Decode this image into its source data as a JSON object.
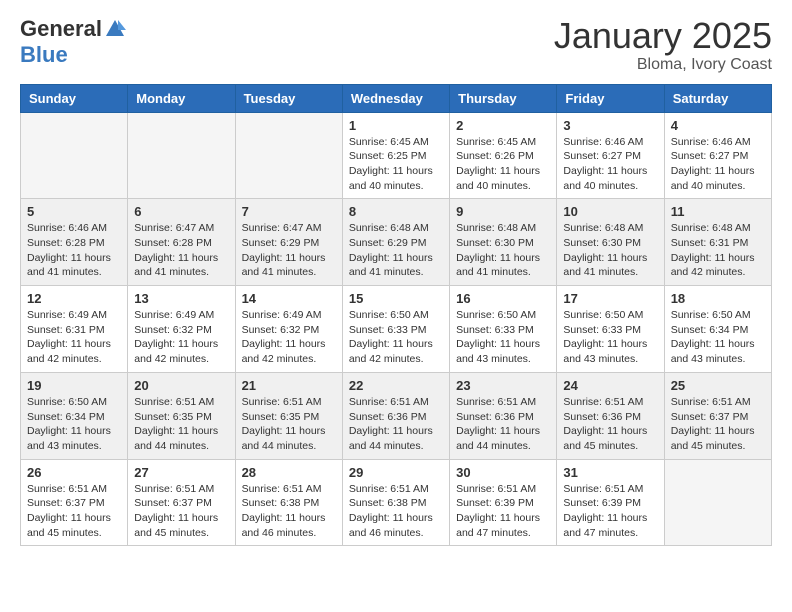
{
  "logo": {
    "general": "General",
    "blue": "Blue"
  },
  "title": "January 2025",
  "subtitle": "Bloma, Ivory Coast",
  "weekdays": [
    "Sunday",
    "Monday",
    "Tuesday",
    "Wednesday",
    "Thursday",
    "Friday",
    "Saturday"
  ],
  "weeks": [
    [
      {
        "day": "",
        "info": ""
      },
      {
        "day": "",
        "info": ""
      },
      {
        "day": "",
        "info": ""
      },
      {
        "day": "1",
        "info": "Sunrise: 6:45 AM\nSunset: 6:25 PM\nDaylight: 11 hours\nand 40 minutes."
      },
      {
        "day": "2",
        "info": "Sunrise: 6:45 AM\nSunset: 6:26 PM\nDaylight: 11 hours\nand 40 minutes."
      },
      {
        "day": "3",
        "info": "Sunrise: 6:46 AM\nSunset: 6:27 PM\nDaylight: 11 hours\nand 40 minutes."
      },
      {
        "day": "4",
        "info": "Sunrise: 6:46 AM\nSunset: 6:27 PM\nDaylight: 11 hours\nand 40 minutes."
      }
    ],
    [
      {
        "day": "5",
        "info": "Sunrise: 6:46 AM\nSunset: 6:28 PM\nDaylight: 11 hours\nand 41 minutes."
      },
      {
        "day": "6",
        "info": "Sunrise: 6:47 AM\nSunset: 6:28 PM\nDaylight: 11 hours\nand 41 minutes."
      },
      {
        "day": "7",
        "info": "Sunrise: 6:47 AM\nSunset: 6:29 PM\nDaylight: 11 hours\nand 41 minutes."
      },
      {
        "day": "8",
        "info": "Sunrise: 6:48 AM\nSunset: 6:29 PM\nDaylight: 11 hours\nand 41 minutes."
      },
      {
        "day": "9",
        "info": "Sunrise: 6:48 AM\nSunset: 6:30 PM\nDaylight: 11 hours\nand 41 minutes."
      },
      {
        "day": "10",
        "info": "Sunrise: 6:48 AM\nSunset: 6:30 PM\nDaylight: 11 hours\nand 41 minutes."
      },
      {
        "day": "11",
        "info": "Sunrise: 6:48 AM\nSunset: 6:31 PM\nDaylight: 11 hours\nand 42 minutes."
      }
    ],
    [
      {
        "day": "12",
        "info": "Sunrise: 6:49 AM\nSunset: 6:31 PM\nDaylight: 11 hours\nand 42 minutes."
      },
      {
        "day": "13",
        "info": "Sunrise: 6:49 AM\nSunset: 6:32 PM\nDaylight: 11 hours\nand 42 minutes."
      },
      {
        "day": "14",
        "info": "Sunrise: 6:49 AM\nSunset: 6:32 PM\nDaylight: 11 hours\nand 42 minutes."
      },
      {
        "day": "15",
        "info": "Sunrise: 6:50 AM\nSunset: 6:33 PM\nDaylight: 11 hours\nand 42 minutes."
      },
      {
        "day": "16",
        "info": "Sunrise: 6:50 AM\nSunset: 6:33 PM\nDaylight: 11 hours\nand 43 minutes."
      },
      {
        "day": "17",
        "info": "Sunrise: 6:50 AM\nSunset: 6:33 PM\nDaylight: 11 hours\nand 43 minutes."
      },
      {
        "day": "18",
        "info": "Sunrise: 6:50 AM\nSunset: 6:34 PM\nDaylight: 11 hours\nand 43 minutes."
      }
    ],
    [
      {
        "day": "19",
        "info": "Sunrise: 6:50 AM\nSunset: 6:34 PM\nDaylight: 11 hours\nand 43 minutes."
      },
      {
        "day": "20",
        "info": "Sunrise: 6:51 AM\nSunset: 6:35 PM\nDaylight: 11 hours\nand 44 minutes."
      },
      {
        "day": "21",
        "info": "Sunrise: 6:51 AM\nSunset: 6:35 PM\nDaylight: 11 hours\nand 44 minutes."
      },
      {
        "day": "22",
        "info": "Sunrise: 6:51 AM\nSunset: 6:36 PM\nDaylight: 11 hours\nand 44 minutes."
      },
      {
        "day": "23",
        "info": "Sunrise: 6:51 AM\nSunset: 6:36 PM\nDaylight: 11 hours\nand 44 minutes."
      },
      {
        "day": "24",
        "info": "Sunrise: 6:51 AM\nSunset: 6:36 PM\nDaylight: 11 hours\nand 45 minutes."
      },
      {
        "day": "25",
        "info": "Sunrise: 6:51 AM\nSunset: 6:37 PM\nDaylight: 11 hours\nand 45 minutes."
      }
    ],
    [
      {
        "day": "26",
        "info": "Sunrise: 6:51 AM\nSunset: 6:37 PM\nDaylight: 11 hours\nand 45 minutes."
      },
      {
        "day": "27",
        "info": "Sunrise: 6:51 AM\nSunset: 6:37 PM\nDaylight: 11 hours\nand 45 minutes."
      },
      {
        "day": "28",
        "info": "Sunrise: 6:51 AM\nSunset: 6:38 PM\nDaylight: 11 hours\nand 46 minutes."
      },
      {
        "day": "29",
        "info": "Sunrise: 6:51 AM\nSunset: 6:38 PM\nDaylight: 11 hours\nand 46 minutes."
      },
      {
        "day": "30",
        "info": "Sunrise: 6:51 AM\nSunset: 6:39 PM\nDaylight: 11 hours\nand 47 minutes."
      },
      {
        "day": "31",
        "info": "Sunrise: 6:51 AM\nSunset: 6:39 PM\nDaylight: 11 hours\nand 47 minutes."
      },
      {
        "day": "",
        "info": ""
      }
    ]
  ]
}
